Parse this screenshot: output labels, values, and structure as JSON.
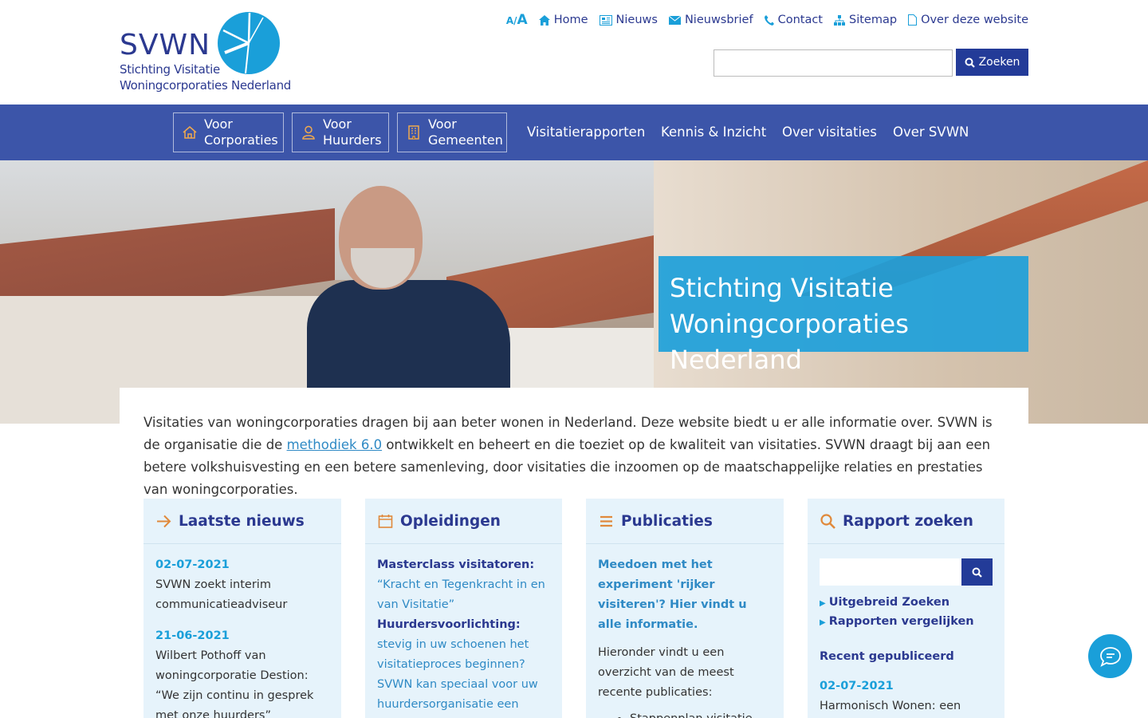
{
  "logo": {
    "title": "SVWN",
    "line1": "Stichting Visitatie",
    "line2": "Woningcorporaties Nederland"
  },
  "topnav": {
    "font_small": "A",
    "slash": "/",
    "font_big": "A",
    "home": "Home",
    "nieuws": "Nieuws",
    "nieuwsbrief": "Nieuwsbrief",
    "contact": "Contact",
    "sitemap": "Sitemap",
    "over": "Over deze website"
  },
  "search": {
    "value": "",
    "button": "Zoeken"
  },
  "mainnav": {
    "corporaties": [
      "Voor",
      "Corporaties"
    ],
    "huurders": [
      "Voor",
      "Huurders"
    ],
    "gemeenten": [
      "Voor",
      "Gemeenten"
    ],
    "links": [
      "Visitatierapporten",
      "Kennis & Inzicht",
      "Over visitaties",
      "Over SVWN"
    ]
  },
  "hero": {
    "title_line1": "Stichting Visitatie",
    "title_line2": "Woningcorporaties Nederland"
  },
  "intro": {
    "part1": "Visitaties van woningcorporaties dragen bij aan beter wonen in Nederland. Deze website biedt u er alle informatie over. SVWN is de organisatie die de ",
    "link": "methodiek 6.0",
    "part2": " ontwikkelt en beheert en die toeziet op de kwaliteit van visitaties. SVWN draagt bij aan een betere volkshuisvesting en een betere samenleving, door visitaties die inzoomen op de maatschappelijke relaties en prestaties van woningcorporaties."
  },
  "cards": {
    "nieuws": {
      "title": "Laatste nieuws",
      "items": [
        {
          "date": "02-07-2021",
          "text": "SVWN zoekt interim communicatieadviseur"
        },
        {
          "date": "21-06-2021",
          "text": "Wilbert Pothoff van woningcorporatie Destion: “We zijn continu in gesprek met onze huurders”"
        }
      ]
    },
    "opleidingen": {
      "title": "Opleidingen",
      "item1_bold": "Masterclass visitatoren:",
      "item1_text": " “Kracht en Tegenkracht in en van Visitatie”",
      "item2_bold": "Huurdersvoorlichting:",
      "item2_text": " stevig in uw schoenen het visitatieproces beginnen? SVWN kan speciaal voor uw huurdersorganisatie een workshop organiseren. Dan"
    },
    "publicaties": {
      "title": "Publicaties",
      "highlight": "Meedoen met het experiment 'rijker visiteren'? Hier vindt u alle informatie.",
      "text": "Hieronder vindt u een overzicht van de meest recente publicaties:",
      "list": [
        "Stappenplan visitatie voor de werkwijze"
      ]
    },
    "rapport": {
      "title": "Rapport zoeken",
      "link1": "Uitgebreid Zoeken",
      "link2": "Rapporten vergelijken",
      "recent_label": "Recent gepubliceerd",
      "recent_date": "02-07-2021",
      "recent_text": "Harmonisch Wonen: een"
    }
  },
  "colors": {
    "brand_dark": "#2b3990",
    "brand_light": "#1a9fd9",
    "nav_bg": "#3c55a9",
    "accent": "#e0893b",
    "card_bg": "#e6f3fb"
  }
}
